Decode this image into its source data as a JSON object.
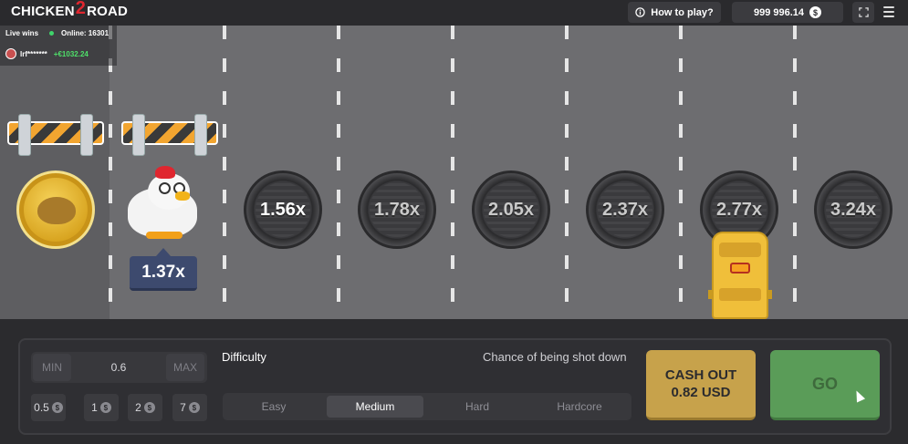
{
  "header": {
    "logo_part1": "CHICKEN",
    "logo_part2": "2",
    "logo_part3": "ROAD",
    "how_to_play": "How to play?",
    "balance": "999 996.14",
    "currency_icon": "$"
  },
  "live_wins": {
    "title": "Live wins",
    "online": "Online: 16301",
    "user": "lrf*******",
    "amount": "+€1032.24"
  },
  "game": {
    "current_multiplier": "1.37x",
    "manholes": [
      "1.56x",
      "1.78x",
      "2.05x",
      "2.37x",
      "2.77x",
      "3.24x"
    ]
  },
  "controls": {
    "min_label": "MIN",
    "bet_value": "0.6",
    "max_label": "MAX",
    "chips": [
      "0.5",
      "1",
      "2",
      "7"
    ],
    "difficulty_label": "Difficulty",
    "chance_label": "Chance of being shot down",
    "difficulty_options": [
      "Easy",
      "Medium",
      "Hard",
      "Hardcore"
    ],
    "selected_difficulty": "Medium",
    "cashout_line1": "CASH OUT",
    "cashout_line2": "0.82 USD",
    "go_label": "GO"
  }
}
